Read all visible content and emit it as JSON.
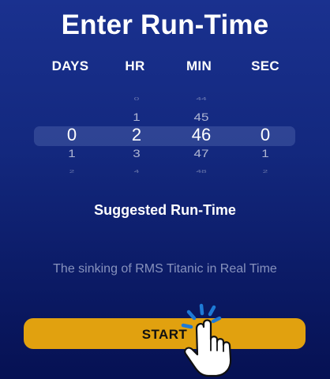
{
  "header": {
    "title": "Enter Run-Time"
  },
  "picker": {
    "columns": [
      {
        "label": "DAYS",
        "above2": "",
        "above1": "",
        "selected": "0",
        "below1": "1",
        "below2": "2"
      },
      {
        "label": "HR",
        "above2": "0",
        "above1": "1",
        "selected": "2",
        "below1": "3",
        "below2": "4"
      },
      {
        "label": "MIN",
        "above2": "44",
        "above1": "45",
        "selected": "46",
        "below1": "47",
        "below2": "48"
      },
      {
        "label": "SEC",
        "above2": "",
        "above1": "",
        "selected": "0",
        "below1": "1",
        "below2": "2"
      }
    ]
  },
  "suggested": {
    "heading": "Suggested Run-Time",
    "description": "The sinking of RMS Titanic in Real Time"
  },
  "start_button": {
    "label": "START"
  },
  "icons": {
    "tap_hint": "hand-tap-icon"
  },
  "colors": {
    "background_top": "#1a318f",
    "background_bottom": "#061153",
    "button": "#e1a10f",
    "subtitle": "#8792bd",
    "tap_accent": "#1e7ad6"
  }
}
